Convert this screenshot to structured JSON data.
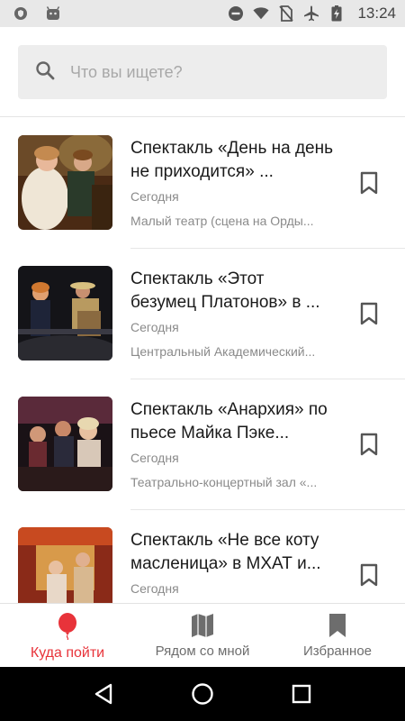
{
  "status_bar": {
    "time": "13:24"
  },
  "search": {
    "placeholder": "Что вы ищете?",
    "value": ""
  },
  "events": [
    {
      "title": "Спектакль «День на день не приходится» ...",
      "date": "Сегодня",
      "venue": "Малый театр (сцена на Орды...",
      "image": "stage-scene-photo"
    },
    {
      "title": "Спектакль «Этот безумец Платонов» в ...",
      "date": "Сегодня",
      "venue": "Центральный Академический...",
      "image": "stage-scene-photo"
    },
    {
      "title": "Спектакль «Анархия» по пьесе Майка Пэке...",
      "date": "Сегодня",
      "venue": "Театрально-концертный зал «...",
      "image": "stage-scene-photo"
    },
    {
      "title": "Спектакль «Не все коту масленица» в МХАТ и...",
      "date": "Сегодня",
      "venue": "",
      "image": "stage-scene-photo"
    }
  ],
  "tabs": [
    {
      "label": "Куда пойти",
      "icon": "balloon-icon",
      "active": true
    },
    {
      "label": "Рядом со мной",
      "icon": "map-icon",
      "active": false
    },
    {
      "label": "Избранное",
      "icon": "bookmark-icon",
      "active": false
    }
  ],
  "colors": {
    "accent": "#e8333a",
    "tab_inactive": "#6d6d6d",
    "search_bg": "#ededed",
    "status_bg": "#e8e8e8"
  }
}
